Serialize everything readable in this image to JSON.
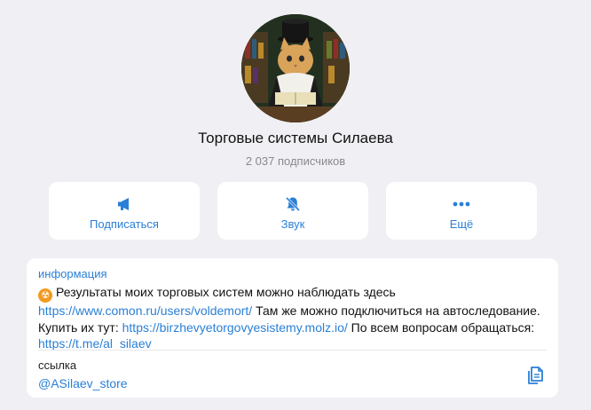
{
  "channel": {
    "title": "Торговые системы Силаева",
    "subscribers": "2 037 подписчиков",
    "avatar_icon": "cat-wizard-avatar"
  },
  "actions": [
    {
      "label": "Подписаться",
      "icon": "megaphone-icon"
    },
    {
      "label": "Звук",
      "icon": "bell-muted-icon"
    },
    {
      "label": "Ещё",
      "icon": "more-dots-icon"
    }
  ],
  "info": {
    "label": "информация",
    "emoji": "☢",
    "text_part1": "Результаты моих торговых систем можно наблюдать здесь ",
    "link1": "https://www.comon.ru/users/voldemort/",
    "text_part2": "  Там же можно подключиться на автоследование. Купить их тут: ",
    "link2": "https://birzhevyetorgovyesistemy.molz.io/",
    "text_part3": " По всем вопросам обращаться:  ",
    "link3": "https://t.me/al_silaev"
  },
  "link_section": {
    "label": "ссылка",
    "value": "@ASilaev_store",
    "copy_icon": "copy-icon"
  },
  "colors": {
    "accent": "#2a7fd6",
    "background": "#f0f0f4",
    "card": "#ffffff",
    "muted_text": "#8a8a8e"
  }
}
